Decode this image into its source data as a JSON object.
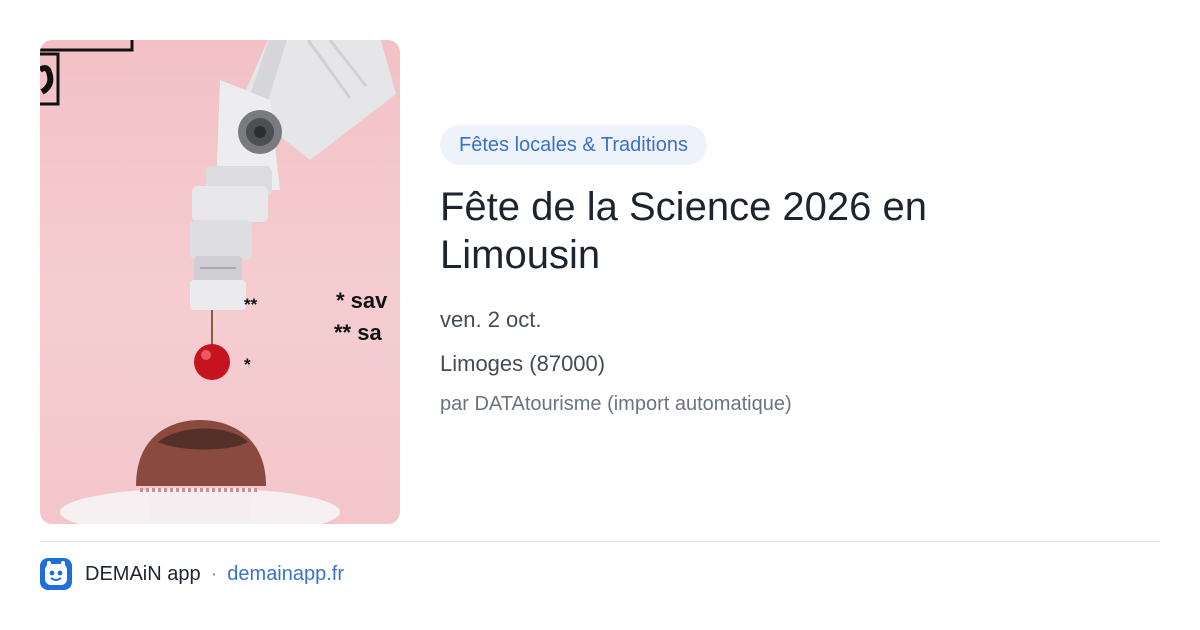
{
  "card": {
    "category": "Fêtes locales & Traditions",
    "title": "Fête de la Science 2026 en Limousin",
    "date": "ven. 2 oct.",
    "place": "Limoges (87000)",
    "author": "par DATAtourisme (import automatique)"
  },
  "poster": {
    "note_1": "* sav",
    "note_2": "** sa",
    "marker_double": "**",
    "marker_single": "*"
  },
  "footer": {
    "app_name": "DEMAiN app",
    "separator": "·",
    "link": "demainapp.fr"
  },
  "colors": {
    "accent": "#3a72c8",
    "category_bg": "#eef3fb",
    "poster_bg": "#f3c4c9"
  }
}
